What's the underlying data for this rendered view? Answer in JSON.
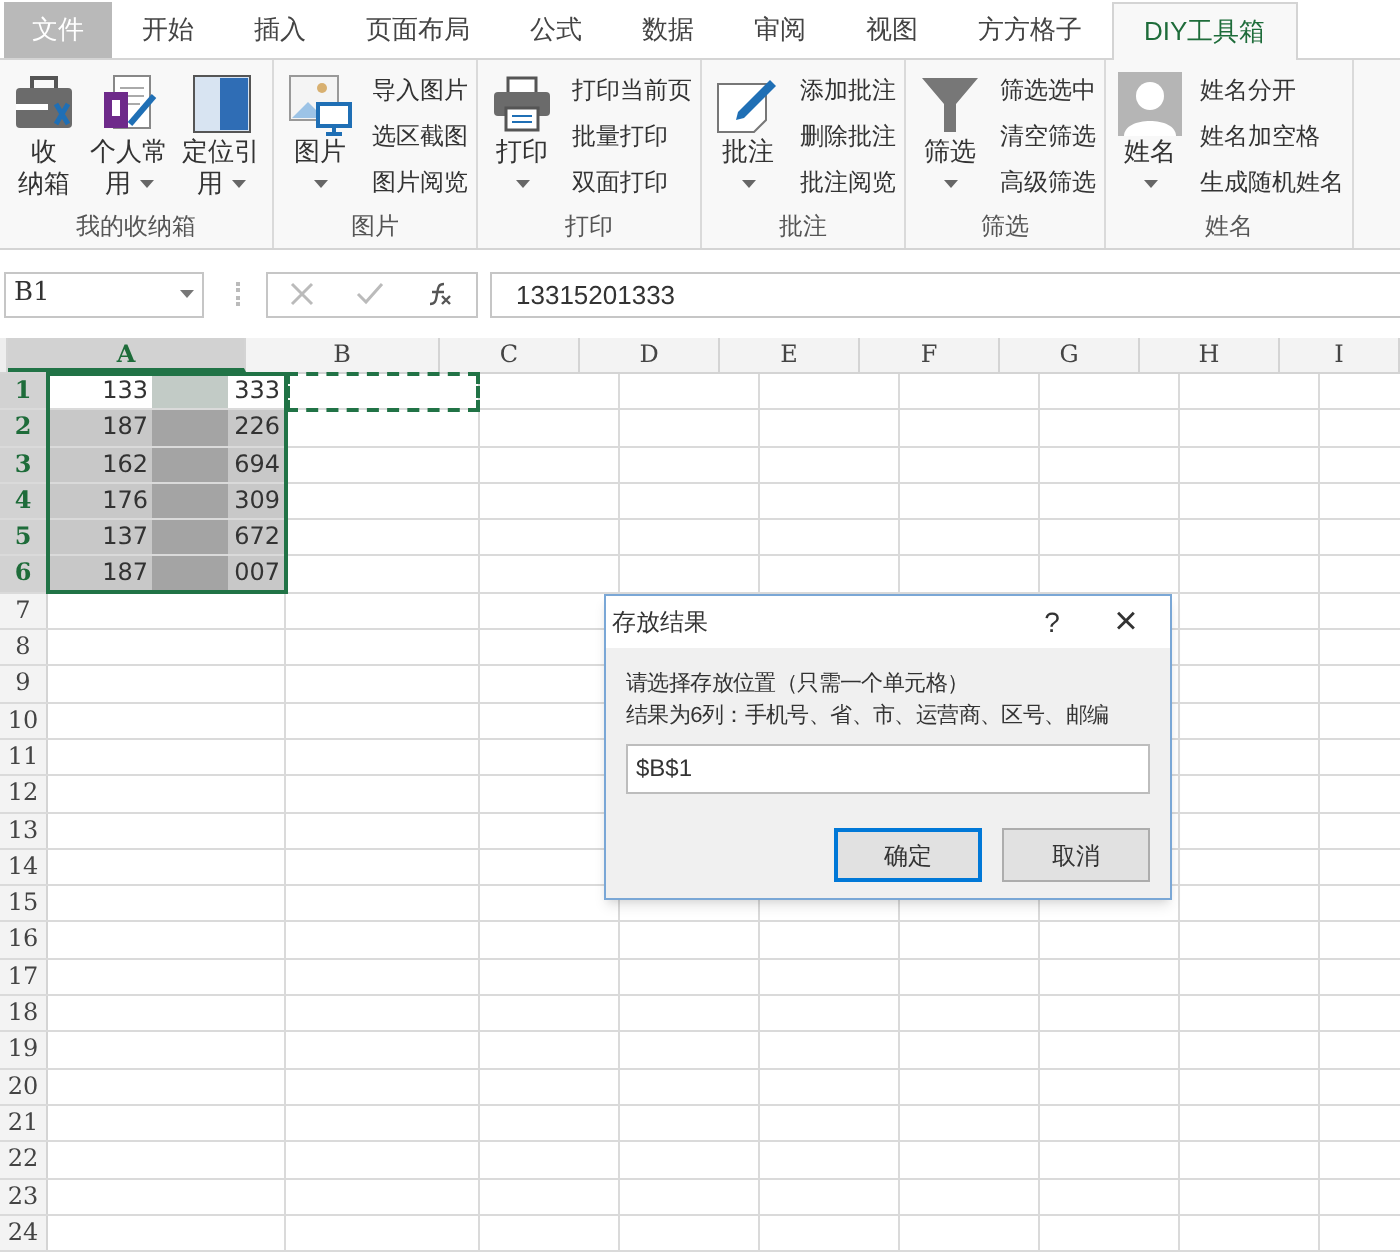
{
  "tabs": [
    {
      "label": "文件",
      "kind": "file",
      "selected": false
    },
    {
      "label": "开始",
      "kind": "tab",
      "selected": false
    },
    {
      "label": "插入",
      "kind": "tab",
      "selected": false
    },
    {
      "label": "页面布局",
      "kind": "tab",
      "selected": false
    },
    {
      "label": "公式",
      "kind": "tab",
      "selected": false
    },
    {
      "label": "数据",
      "kind": "tab",
      "selected": false
    },
    {
      "label": "审阅",
      "kind": "tab",
      "selected": false
    },
    {
      "label": "视图",
      "kind": "tab",
      "selected": false
    },
    {
      "label": "方方格子",
      "kind": "tab",
      "selected": false
    },
    {
      "label": "DIY工具箱",
      "kind": "tab",
      "selected": true
    }
  ],
  "ribbon_groups": [
    {
      "title": "我的收纳箱",
      "large_buttons": [
        {
          "kind": "toolbox",
          "lines": [
            "收",
            "纳箱"
          ],
          "dropdown": false
        },
        {
          "kind": "notebook",
          "lines": [
            "个人常",
            "用"
          ],
          "dropdown": true
        },
        {
          "kind": "panel",
          "lines": [
            "定位引",
            "用"
          ],
          "dropdown": true
        }
      ]
    },
    {
      "title": "图片",
      "large_buttons": [
        {
          "kind": "picture",
          "lines": [
            "图片"
          ],
          "dropdown": true
        }
      ],
      "small_buttons": [
        "导入图片",
        "选区截图",
        "图片阅览"
      ]
    },
    {
      "title": "打印",
      "large_buttons": [
        {
          "kind": "printer",
          "lines": [
            "打印"
          ],
          "dropdown": true
        }
      ],
      "small_buttons": [
        "打印当前页",
        "批量打印",
        "双面打印"
      ]
    },
    {
      "title": "批注",
      "large_buttons": [
        {
          "kind": "note",
          "lines": [
            "批注"
          ],
          "dropdown": true
        }
      ],
      "small_buttons": [
        "添加批注",
        "删除批注",
        "批注阅览"
      ]
    },
    {
      "title": "筛选",
      "large_buttons": [
        {
          "kind": "funnel",
          "lines": [
            "筛选"
          ],
          "dropdown": true
        }
      ],
      "small_buttons": [
        "筛选选中",
        "清空筛选",
        "高级筛选"
      ]
    },
    {
      "title": "姓名",
      "large_buttons": [
        {
          "kind": "person",
          "lines": [
            "姓名"
          ],
          "dropdown": true
        }
      ],
      "small_buttons": [
        "姓名分开",
        "姓名加空格",
        "生成随机姓名"
      ]
    }
  ],
  "name_box": "B1",
  "formula": "13315201333",
  "sheet": {
    "columns": [
      {
        "label": "A",
        "selected": true
      },
      {
        "label": "B",
        "selected": false
      },
      {
        "label": "C",
        "selected": false
      },
      {
        "label": "D",
        "selected": false
      },
      {
        "label": "E",
        "selected": false
      },
      {
        "label": "F",
        "selected": false
      },
      {
        "label": "G",
        "selected": false
      },
      {
        "label": "H",
        "selected": false
      },
      {
        "label": "I",
        "selected": false
      }
    ],
    "rows": [
      {
        "number": "1",
        "selected": true,
        "start": "133",
        "end": "333"
      },
      {
        "number": "2",
        "selected": true,
        "start": "187",
        "end": "226"
      },
      {
        "number": "3",
        "selected": true,
        "start": "162",
        "end": "694"
      },
      {
        "number": "4",
        "selected": true,
        "start": "176",
        "end": "309"
      },
      {
        "number": "5",
        "selected": true,
        "start": "137",
        "end": "672"
      },
      {
        "number": "6",
        "selected": true,
        "start": "187",
        "end": "007"
      },
      {
        "number": "7",
        "selected": false
      },
      {
        "number": "8",
        "selected": false
      },
      {
        "number": "9",
        "selected": false
      },
      {
        "number": "10",
        "selected": false
      },
      {
        "number": "11",
        "selected": false
      },
      {
        "number": "12",
        "selected": false
      },
      {
        "number": "13",
        "selected": false
      },
      {
        "number": "14",
        "selected": false
      },
      {
        "number": "15",
        "selected": false
      },
      {
        "number": "16",
        "selected": false
      },
      {
        "number": "17",
        "selected": false
      },
      {
        "number": "18",
        "selected": false
      },
      {
        "number": "19",
        "selected": false
      },
      {
        "number": "20",
        "selected": false
      },
      {
        "number": "21",
        "selected": false
      },
      {
        "number": "22",
        "selected": false
      },
      {
        "number": "23",
        "selected": false
      },
      {
        "number": "24",
        "selected": false
      }
    ]
  },
  "dialog": {
    "title": "存放结果",
    "help": "?",
    "close": "×",
    "lines": [
      "请选择存放位置（只需一个单元格）",
      "结果为6列：手机号、省、市、运营商、区号、邮编"
    ],
    "value": "$B$1",
    "buttons": [
      {
        "label": "确定",
        "selected": true
      },
      {
        "label": "取消",
        "selected": false
      }
    ]
  }
}
